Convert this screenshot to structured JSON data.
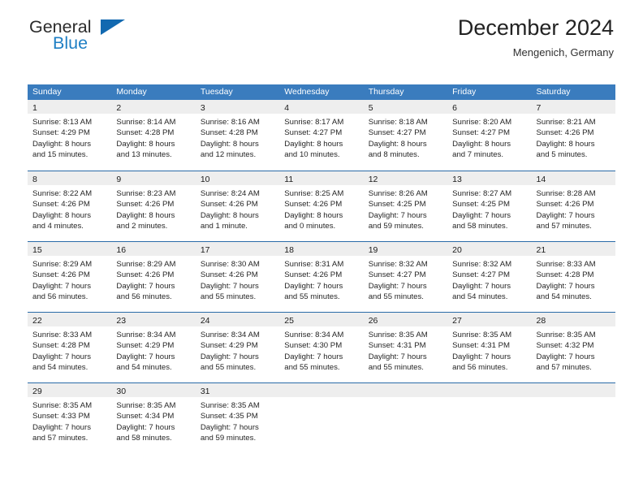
{
  "brand": {
    "name_part1": "General",
    "name_part2": "Blue",
    "accent_color": "#1269b0"
  },
  "header": {
    "title": "December 2024",
    "subtitle": "Mengenich, Germany"
  },
  "theme": {
    "header_blue": "#3a7cbe",
    "divider_blue": "#2a6ba8",
    "daynum_band": "#eeeeee"
  },
  "weekdays": [
    "Sunday",
    "Monday",
    "Tuesday",
    "Wednesday",
    "Thursday",
    "Friday",
    "Saturday"
  ],
  "weeks": [
    [
      {
        "day": "1",
        "sunrise": "Sunrise: 8:13 AM",
        "sunset": "Sunset: 4:29 PM",
        "daylight1": "Daylight: 8 hours",
        "daylight2": "and 15 minutes."
      },
      {
        "day": "2",
        "sunrise": "Sunrise: 8:14 AM",
        "sunset": "Sunset: 4:28 PM",
        "daylight1": "Daylight: 8 hours",
        "daylight2": "and 13 minutes."
      },
      {
        "day": "3",
        "sunrise": "Sunrise: 8:16 AM",
        "sunset": "Sunset: 4:28 PM",
        "daylight1": "Daylight: 8 hours",
        "daylight2": "and 12 minutes."
      },
      {
        "day": "4",
        "sunrise": "Sunrise: 8:17 AM",
        "sunset": "Sunset: 4:27 PM",
        "daylight1": "Daylight: 8 hours",
        "daylight2": "and 10 minutes."
      },
      {
        "day": "5",
        "sunrise": "Sunrise: 8:18 AM",
        "sunset": "Sunset: 4:27 PM",
        "daylight1": "Daylight: 8 hours",
        "daylight2": "and 8 minutes."
      },
      {
        "day": "6",
        "sunrise": "Sunrise: 8:20 AM",
        "sunset": "Sunset: 4:27 PM",
        "daylight1": "Daylight: 8 hours",
        "daylight2": "and 7 minutes."
      },
      {
        "day": "7",
        "sunrise": "Sunrise: 8:21 AM",
        "sunset": "Sunset: 4:26 PM",
        "daylight1": "Daylight: 8 hours",
        "daylight2": "and 5 minutes."
      }
    ],
    [
      {
        "day": "8",
        "sunrise": "Sunrise: 8:22 AM",
        "sunset": "Sunset: 4:26 PM",
        "daylight1": "Daylight: 8 hours",
        "daylight2": "and 4 minutes."
      },
      {
        "day": "9",
        "sunrise": "Sunrise: 8:23 AM",
        "sunset": "Sunset: 4:26 PM",
        "daylight1": "Daylight: 8 hours",
        "daylight2": "and 2 minutes."
      },
      {
        "day": "10",
        "sunrise": "Sunrise: 8:24 AM",
        "sunset": "Sunset: 4:26 PM",
        "daylight1": "Daylight: 8 hours",
        "daylight2": "and 1 minute."
      },
      {
        "day": "11",
        "sunrise": "Sunrise: 8:25 AM",
        "sunset": "Sunset: 4:26 PM",
        "daylight1": "Daylight: 8 hours",
        "daylight2": "and 0 minutes."
      },
      {
        "day": "12",
        "sunrise": "Sunrise: 8:26 AM",
        "sunset": "Sunset: 4:25 PM",
        "daylight1": "Daylight: 7 hours",
        "daylight2": "and 59 minutes."
      },
      {
        "day": "13",
        "sunrise": "Sunrise: 8:27 AM",
        "sunset": "Sunset: 4:25 PM",
        "daylight1": "Daylight: 7 hours",
        "daylight2": "and 58 minutes."
      },
      {
        "day": "14",
        "sunrise": "Sunrise: 8:28 AM",
        "sunset": "Sunset: 4:26 PM",
        "daylight1": "Daylight: 7 hours",
        "daylight2": "and 57 minutes."
      }
    ],
    [
      {
        "day": "15",
        "sunrise": "Sunrise: 8:29 AM",
        "sunset": "Sunset: 4:26 PM",
        "daylight1": "Daylight: 7 hours",
        "daylight2": "and 56 minutes."
      },
      {
        "day": "16",
        "sunrise": "Sunrise: 8:29 AM",
        "sunset": "Sunset: 4:26 PM",
        "daylight1": "Daylight: 7 hours",
        "daylight2": "and 56 minutes."
      },
      {
        "day": "17",
        "sunrise": "Sunrise: 8:30 AM",
        "sunset": "Sunset: 4:26 PM",
        "daylight1": "Daylight: 7 hours",
        "daylight2": "and 55 minutes."
      },
      {
        "day": "18",
        "sunrise": "Sunrise: 8:31 AM",
        "sunset": "Sunset: 4:26 PM",
        "daylight1": "Daylight: 7 hours",
        "daylight2": "and 55 minutes."
      },
      {
        "day": "19",
        "sunrise": "Sunrise: 8:32 AM",
        "sunset": "Sunset: 4:27 PM",
        "daylight1": "Daylight: 7 hours",
        "daylight2": "and 55 minutes."
      },
      {
        "day": "20",
        "sunrise": "Sunrise: 8:32 AM",
        "sunset": "Sunset: 4:27 PM",
        "daylight1": "Daylight: 7 hours",
        "daylight2": "and 54 minutes."
      },
      {
        "day": "21",
        "sunrise": "Sunrise: 8:33 AM",
        "sunset": "Sunset: 4:28 PM",
        "daylight1": "Daylight: 7 hours",
        "daylight2": "and 54 minutes."
      }
    ],
    [
      {
        "day": "22",
        "sunrise": "Sunrise: 8:33 AM",
        "sunset": "Sunset: 4:28 PM",
        "daylight1": "Daylight: 7 hours",
        "daylight2": "and 54 minutes."
      },
      {
        "day": "23",
        "sunrise": "Sunrise: 8:34 AM",
        "sunset": "Sunset: 4:29 PM",
        "daylight1": "Daylight: 7 hours",
        "daylight2": "and 54 minutes."
      },
      {
        "day": "24",
        "sunrise": "Sunrise: 8:34 AM",
        "sunset": "Sunset: 4:29 PM",
        "daylight1": "Daylight: 7 hours",
        "daylight2": "and 55 minutes."
      },
      {
        "day": "25",
        "sunrise": "Sunrise: 8:34 AM",
        "sunset": "Sunset: 4:30 PM",
        "daylight1": "Daylight: 7 hours",
        "daylight2": "and 55 minutes."
      },
      {
        "day": "26",
        "sunrise": "Sunrise: 8:35 AM",
        "sunset": "Sunset: 4:31 PM",
        "daylight1": "Daylight: 7 hours",
        "daylight2": "and 55 minutes."
      },
      {
        "day": "27",
        "sunrise": "Sunrise: 8:35 AM",
        "sunset": "Sunset: 4:31 PM",
        "daylight1": "Daylight: 7 hours",
        "daylight2": "and 56 minutes."
      },
      {
        "day": "28",
        "sunrise": "Sunrise: 8:35 AM",
        "sunset": "Sunset: 4:32 PM",
        "daylight1": "Daylight: 7 hours",
        "daylight2": "and 57 minutes."
      }
    ],
    [
      {
        "day": "29",
        "sunrise": "Sunrise: 8:35 AM",
        "sunset": "Sunset: 4:33 PM",
        "daylight1": "Daylight: 7 hours",
        "daylight2": "and 57 minutes."
      },
      {
        "day": "30",
        "sunrise": "Sunrise: 8:35 AM",
        "sunset": "Sunset: 4:34 PM",
        "daylight1": "Daylight: 7 hours",
        "daylight2": "and 58 minutes."
      },
      {
        "day": "31",
        "sunrise": "Sunrise: 8:35 AM",
        "sunset": "Sunset: 4:35 PM",
        "daylight1": "Daylight: 7 hours",
        "daylight2": "and 59 minutes."
      },
      {
        "day": "",
        "sunrise": "",
        "sunset": "",
        "daylight1": "",
        "daylight2": ""
      },
      {
        "day": "",
        "sunrise": "",
        "sunset": "",
        "daylight1": "",
        "daylight2": ""
      },
      {
        "day": "",
        "sunrise": "",
        "sunset": "",
        "daylight1": "",
        "daylight2": ""
      },
      {
        "day": "",
        "sunrise": "",
        "sunset": "",
        "daylight1": "",
        "daylight2": ""
      }
    ]
  ]
}
